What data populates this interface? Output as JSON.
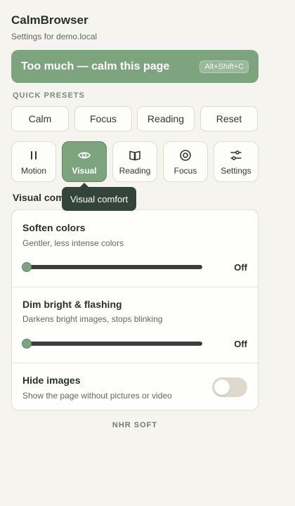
{
  "app": {
    "title": "CalmBrowser",
    "subtitle": "Settings for demo.local"
  },
  "calm_button": {
    "label": "Too much — calm this page",
    "shortcut": "Alt+Shift+C"
  },
  "presets": {
    "heading": "QUICK PRESETS",
    "items": [
      {
        "label": "Calm"
      },
      {
        "label": "Focus"
      },
      {
        "label": "Reading"
      },
      {
        "label": "Reset"
      }
    ]
  },
  "tabs": [
    {
      "label": "Motion",
      "icon": "pause-icon",
      "active": false
    },
    {
      "label": "Visual",
      "icon": "eye-icon",
      "active": true
    },
    {
      "label": "Reading",
      "icon": "book-icon",
      "active": false
    },
    {
      "label": "Focus",
      "icon": "target-icon",
      "active": false
    },
    {
      "label": "Settings",
      "icon": "sliders-icon",
      "active": false
    }
  ],
  "section": {
    "heading": "Visual comfort",
    "tooltip": "Visual comfort"
  },
  "settings": [
    {
      "title": "Soften colors",
      "description": "Gentler, less intense colors",
      "value": "Off",
      "level": 0
    },
    {
      "title": "Dim bright & flashing",
      "description": "Darkens bright images, stops blinking",
      "value": "Off",
      "level": 0
    },
    {
      "title": "Hide images",
      "description": "Show the page without pictures or video",
      "enabled": false
    }
  ],
  "footer": {
    "brand": "NHR SOFT"
  },
  "colors": {
    "accent": "#7ea47f",
    "background": "#f5f4ee",
    "tooltip": "#33443a"
  }
}
